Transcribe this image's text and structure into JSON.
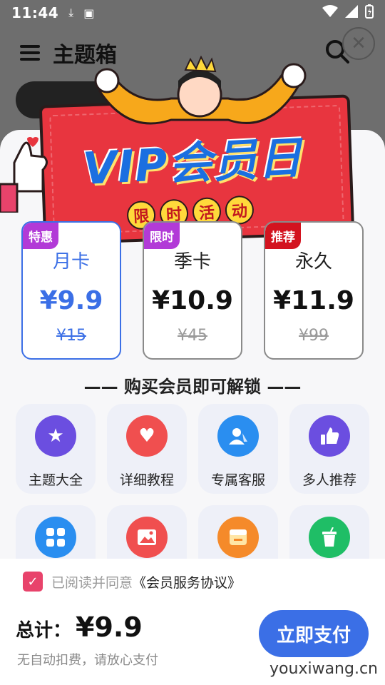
{
  "status_bar": {
    "time": "11:44"
  },
  "app": {
    "title": "主题箱"
  },
  "banner": {
    "title": "VIP会员日",
    "subtitle_chars": [
      "限",
      "时",
      "活",
      "动"
    ]
  },
  "plans": [
    {
      "tag": "特惠",
      "tag_color": "#b23ad7",
      "name": "月卡",
      "price": "¥9.9",
      "original": "¥15",
      "selected": true
    },
    {
      "tag": "限时",
      "tag_color": "#b23ad7",
      "name": "季卡",
      "price": "¥10.9",
      "original": "¥45",
      "selected": false
    },
    {
      "tag": "推荐",
      "tag_color": "#d3131f",
      "name": "永久",
      "price": "¥11.9",
      "original": "¥99",
      "selected": false
    }
  ],
  "unlock_title": "—— 购买会员即可解锁 ——",
  "features": [
    {
      "label": "主题大全",
      "icon": "medal-icon",
      "color": "#6b4ee0"
    },
    {
      "label": "详细教程",
      "icon": "heart-icon",
      "color": "#f04f4f"
    },
    {
      "label": "专属客服",
      "icon": "person-icon",
      "color": "#2a8ef0"
    },
    {
      "label": "多人推荐",
      "icon": "thumbs-up-icon",
      "color": "#6b4ee0"
    },
    {
      "label": "",
      "icon": "grid-icon",
      "color": "#2a8ef0"
    },
    {
      "label": "",
      "icon": "image-icon",
      "color": "#f04f4f"
    },
    {
      "label": "",
      "icon": "store-icon",
      "color": "#f58a2a"
    },
    {
      "label": "",
      "icon": "cup-icon",
      "color": "#1fbe66"
    }
  ],
  "agreement": {
    "prefix": "已阅读并同意",
    "link": "《会员服务协议》",
    "checked": true
  },
  "total": {
    "label": "总计：",
    "value": "¥9.9"
  },
  "note": "无自动扣费，请放心支付",
  "pay_button": "立即支付",
  "watermark": "youxiwang.cn",
  "colors": {
    "accent": "#3b6fe6",
    "checkbox": "#e8436b",
    "banner_red": "#e8353f"
  }
}
